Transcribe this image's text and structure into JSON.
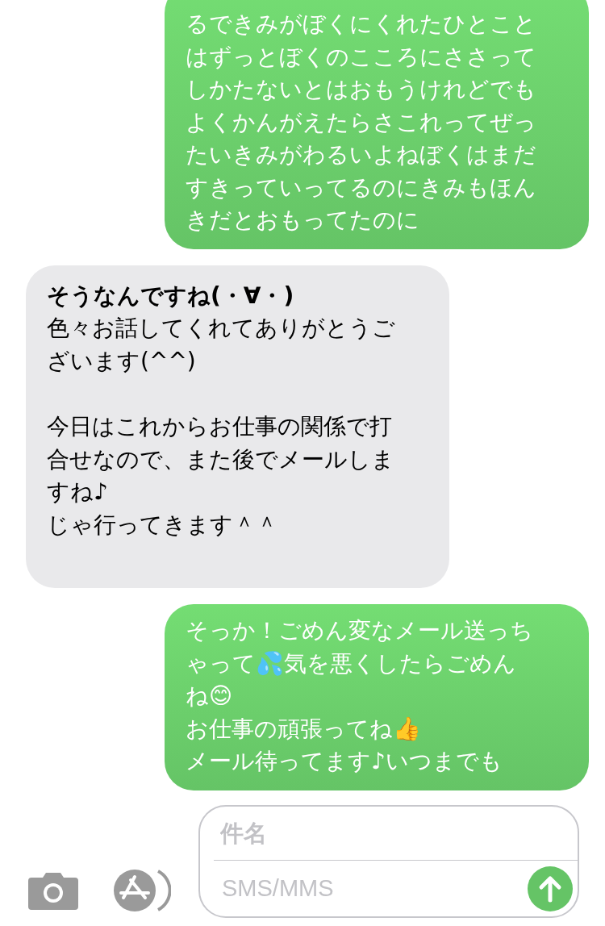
{
  "messages": [
    {
      "kind": "sent",
      "blocks": [
        [
          "るできみがぼくにくれたひとこと",
          "はずっとぼくのこころにささって",
          "しかたないとはおもうけれどでも",
          "よくかんがえたらさこれってぜっ",
          "たいきみがわるいよねぼくはまだ",
          "すきっていってるのにきみもほん",
          "きだとおもってたのに"
        ]
      ]
    },
    {
      "kind": "received",
      "blocks": [
        [
          "**そうなんですね(・∀・)**",
          "色々お話してくれてありがとうご",
          "ざいます(^^)"
        ],
        [
          "今日はこれからお仕事の関係で打",
          "合せなので、また後でメールしま",
          "すね♪",
          "じゃ行ってきます＾＾"
        ]
      ]
    },
    {
      "kind": "sent",
      "blocks": [
        [
          "そっか！ごめん変なメール送っち",
          "ゃって💦気を悪くしたらごめん",
          "ね😊",
          "お仕事の頑張ってね👍",
          "メール待ってます♪いつまでも"
        ]
      ]
    }
  ],
  "composer": {
    "subject_placeholder": "件名",
    "message_placeholder": "SMS/MMS"
  }
}
